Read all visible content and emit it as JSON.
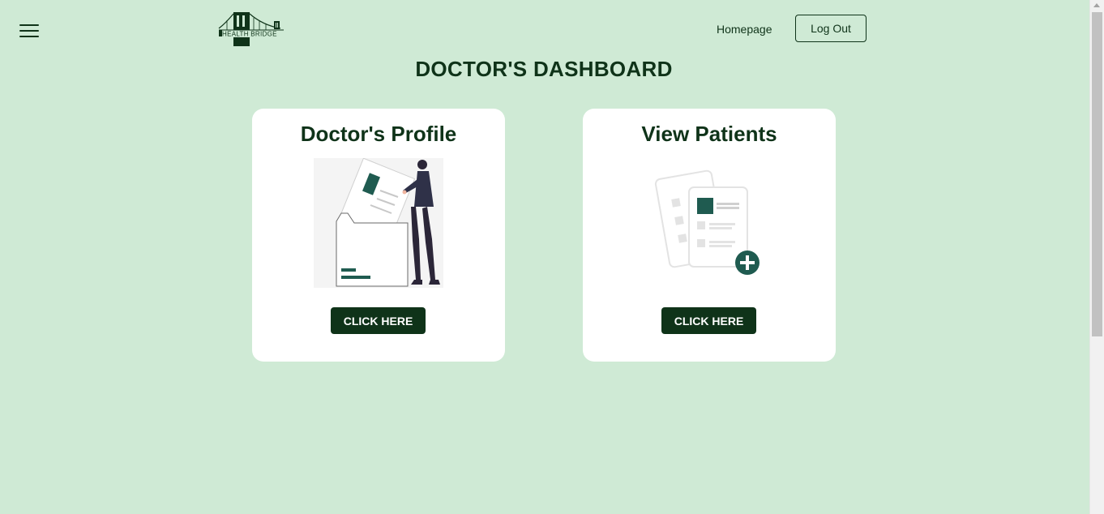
{
  "header": {
    "menu_icon": "hamburger-menu-icon",
    "logo_text": "HEALTH BRIDGE",
    "nav_homepage": "Homepage",
    "logout_label": "Log Out"
  },
  "page": {
    "title": "DOCTOR'S DASHBOARD"
  },
  "cards": [
    {
      "title": "Doctor's Profile",
      "illustration": "person-filing-document-illustration",
      "button_label": "CLICK HERE"
    },
    {
      "title": "View Patients",
      "illustration": "patient-records-add-illustration",
      "button_label": "CLICK HERE"
    }
  ],
  "colors": {
    "background": "#cfead5",
    "primary": "#0f3319",
    "card": "#ffffff",
    "accent": "#1f5b50"
  }
}
